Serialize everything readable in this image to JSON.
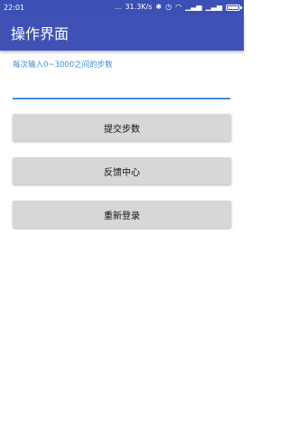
{
  "status_bar": {
    "time": "22:01",
    "dots": "...",
    "network_speed": "31.3K/s",
    "icons": [
      "bluetooth-icon",
      "alarm-icon",
      "wifi-icon",
      "signal-icon",
      "signal-icon",
      "battery-icon"
    ]
  },
  "app_bar": {
    "title": "操作界面"
  },
  "form": {
    "hint": "每次输入0~3000之间的步数",
    "step_value": ""
  },
  "buttons": {
    "submit_steps": "提交步数",
    "feedback_center": "反馈中心",
    "relogin": "重新登录"
  },
  "colors": {
    "app_bar": "#3f51b5",
    "status_bar": "#3b4fb4",
    "accent": "#3f8fd8",
    "button_bg": "#d7d7d7"
  }
}
